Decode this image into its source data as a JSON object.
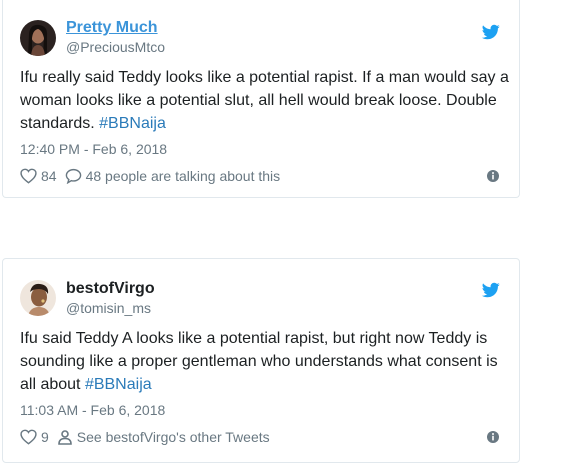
{
  "tweets": [
    {
      "author_name": "Pretty Much",
      "author_handle": "@PreciousMtco",
      "text_before": "Ifu really said Teddy looks like a potential rapist. If a man would say a woman looks like a potential slut, all hell would break loose. Double standards. ",
      "hashtag": "#BBNaija",
      "text_after": "",
      "timestamp": "12:40 PM - Feb 6, 2018",
      "like_count": "84",
      "secondary_action": "48 people are talking about this",
      "secondary_icon": "speech-bubble-icon"
    },
    {
      "author_name": "bestofVirgo",
      "author_handle": "@tomisin_ms",
      "text_before": "Ifu said Teddy A looks like a potential rapist, but right now Teddy is sounding like a proper gentleman who understands what consent is all about ",
      "hashtag": "#BBNaija",
      "text_after": "",
      "timestamp": "11:03 AM - Feb 6, 2018",
      "like_count": "9",
      "secondary_action": "See bestofVirgo's other Tweets",
      "secondary_icon": "person-icon"
    }
  ],
  "colors": {
    "twitter_blue": "#1da1f2",
    "link_blue": "#2b7bb9",
    "muted": "#697882",
    "border": "#e1e8ed"
  }
}
